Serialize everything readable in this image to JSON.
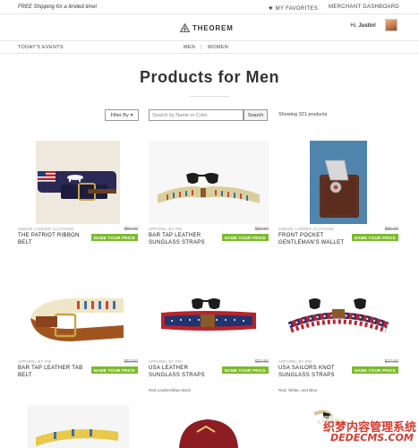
{
  "topbar": {
    "promo": "FREE Shipping for a limited time!",
    "favorites": "MY FAVORITES",
    "dashboard": "MERCHANT DASHBOARD"
  },
  "header": {
    "logo_text": "THEOREM",
    "greeting_prefix": "Hi,",
    "user_name": "Justin!"
  },
  "subnav": {
    "events": "TODAY'S EVENTS",
    "men": "MEN",
    "separator": "|",
    "women": "WOMEN"
  },
  "page": {
    "title": "Products for Men"
  },
  "toolbar": {
    "filter_label": "Filter By",
    "filter_caret": "▾",
    "search_placeholder": "Search by Name or Color",
    "search_button": "Search",
    "showing": "Showing 321 products"
  },
  "products": [
    {
      "brand": "SWEDE LANDER CLOTHING",
      "price": "$50.00",
      "name": "THE PATRIOT RIBBON BELT",
      "badge": "NAME YOUR PRICE",
      "color": ""
    },
    {
      "brand": "APPAREL BY PW",
      "price": "$32.50",
      "name": "BAR TAP LEATHER SUNGLASS STRAPS",
      "badge": "NAME YOUR PRICE",
      "color": ""
    },
    {
      "brand": "SWEDE LANDER CLOTHING",
      "price": "$55.00",
      "name": "FRONT POCKET GENTLEMAN'S WALLET",
      "badge": "NAME YOUR PRICE",
      "color": ""
    },
    {
      "brand": "APPAREL BY PW",
      "price": "$52.50",
      "name": "BAR TAP LEATHER TAB BELT",
      "badge": "NAME YOUR PRICE",
      "color": ""
    },
    {
      "brand": "APPAREL BY PW",
      "price": "$32.50",
      "name": "USA LEATHER SUNGLASS STRAPS",
      "badge": "NAME YOUR PRICE",
      "color": "Red Leather/Blue Back"
    },
    {
      "brand": "APPAREL BY PW",
      "price": "$27.50",
      "name": "USA SAILORS KNOT SUNGLASS STRAPS",
      "badge": "NAME YOUR PRICE",
      "color": "Red, White, and Blue"
    }
  ],
  "watermark": {
    "line1": "织梦内容管理系统",
    "line2": "DEDECMS.COM"
  }
}
